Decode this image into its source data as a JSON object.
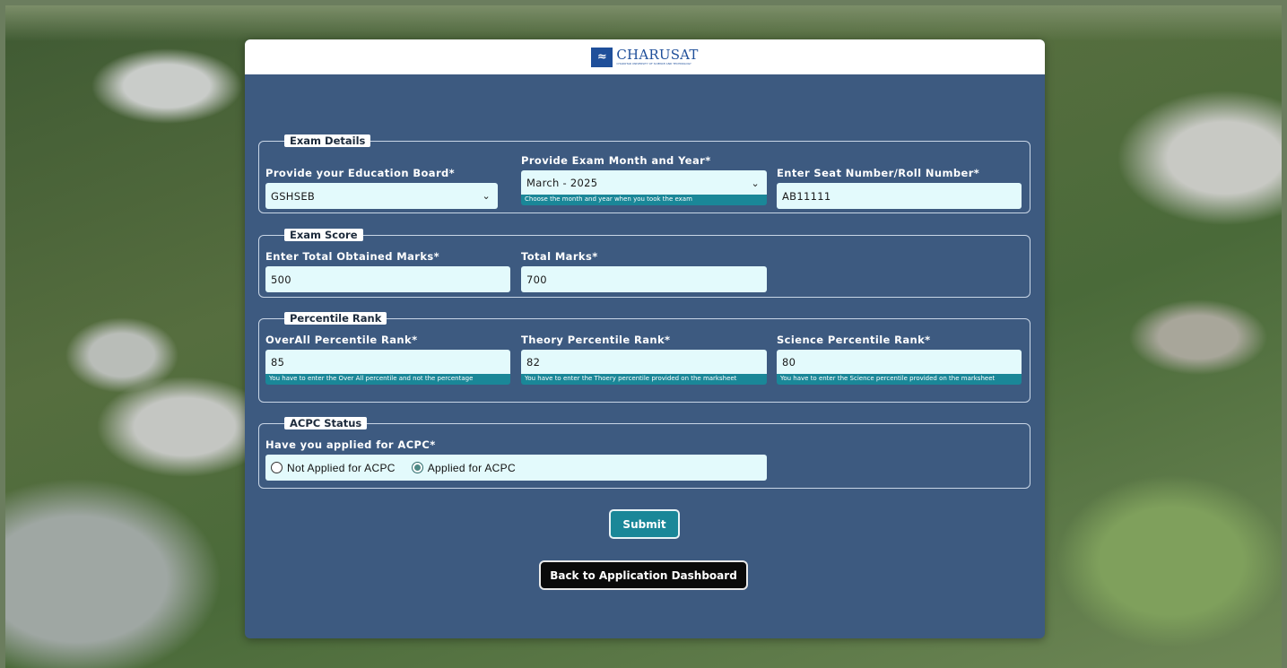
{
  "brand": {
    "logo_text": "CHARUSAT",
    "logo_sub": "CHAROTAR UNIVERSITY OF SCIENCE AND TECHNOLOGY"
  },
  "exam_details": {
    "legend": "Exam Details",
    "board": {
      "label": "Provide your Education Board*",
      "value": "GSHSEB"
    },
    "month_year": {
      "label": "Provide Exam Month and Year*",
      "value": "March - 2025",
      "hint": "Choose the month and year when you took the exam"
    },
    "seat": {
      "label": "Enter Seat Number/Roll Number*",
      "value": "AB11111"
    }
  },
  "exam_score": {
    "legend": "Exam Score",
    "obtained": {
      "label": "Enter Total Obtained Marks*",
      "value": "500"
    },
    "total": {
      "label": "Total Marks*",
      "value": "700"
    }
  },
  "percentile_rank": {
    "legend": "Percentile Rank",
    "overall": {
      "label": "OverAll Percentile Rank*",
      "value": "85",
      "hint": "You have to enter the Over All percentile and not the percentage"
    },
    "theory": {
      "label": "Theory Percentile Rank*",
      "value": "82",
      "hint": "You have to enter the Thoery percentile provided on the marksheet"
    },
    "science": {
      "label": "Science Percentile Rank*",
      "value": "80",
      "hint": "You have to enter the Science percentile provided on the marksheet"
    }
  },
  "acpc_status": {
    "legend": "ACPC Status",
    "question": "Have you applied for ACPC*",
    "options": [
      {
        "label": "Not Applied for ACPC",
        "checked": false
      },
      {
        "label": "Applied for ACPC",
        "checked": true
      }
    ]
  },
  "actions": {
    "submit": "Submit",
    "back": "Back to Application Dashboard"
  }
}
